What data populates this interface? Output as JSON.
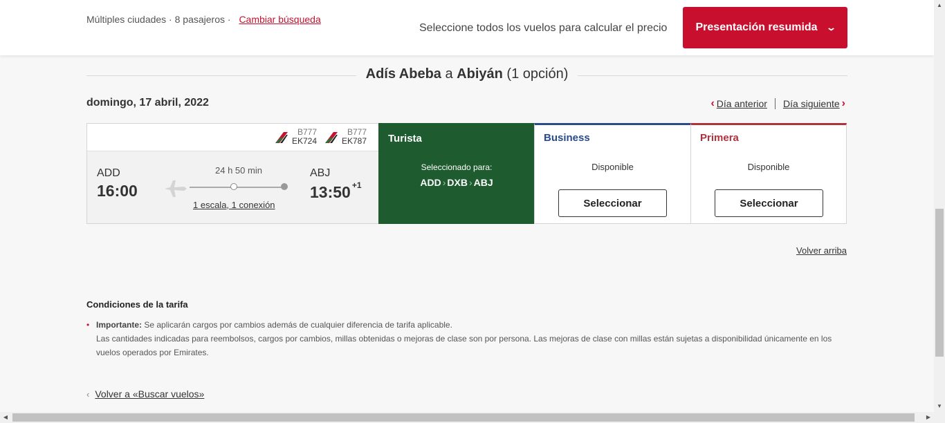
{
  "header": {
    "search_info": "Múltiples ciudades · 8 pasajeros ·",
    "change_search": "Cambiar búsqueda",
    "price_hint": "Seleccione todos los vuelos para calcular el precio",
    "summary_button": "Presentación resumida"
  },
  "route": {
    "origin": "Adís Abeba",
    "connector": "a",
    "destination": "Abiyán",
    "options": "(1 opción)"
  },
  "date": "domingo, 17 abril, 2022",
  "day_nav": {
    "prev": "Día anterior",
    "next": "Día siguiente"
  },
  "flight": {
    "segments": [
      {
        "aircraft": "B777",
        "flight_no": "EK724"
      },
      {
        "aircraft": "B777",
        "flight_no": "EK787"
      }
    ],
    "departure_code": "ADD",
    "departure_time": "16:00",
    "duration": "24 h 50 min",
    "stops": "1 escala, 1 conexión",
    "arrival_code": "ABJ",
    "arrival_time": "13:50",
    "day_offset": "+1"
  },
  "fares": {
    "economy": {
      "name": "Turista",
      "selected_for": "Seleccionado para:",
      "route": [
        "ADD",
        "DXB",
        "ABJ"
      ],
      "color": "#1e5b2e"
    },
    "business": {
      "name": "Business",
      "status": "Disponible",
      "button": "Seleccionar",
      "color": "#2a4a8a"
    },
    "first": {
      "name": "Primera",
      "status": "Disponible",
      "button": "Seleccionar",
      "color": "#b0323c"
    }
  },
  "back_to_top": "Volver arriba",
  "conditions": {
    "title": "Condiciones de la tarifa",
    "important_label": "Importante:",
    "important_text": "Se aplicarán cargos por cambios además de cualquier diferencia de tarifa aplicable.",
    "detail": "Las cantidades indicadas para reembolsos, cargos por cambios, millas obtenidas o mejoras de clase son por persona. Las mejoras de clase con millas están sujetas a disponibilidad únicamente en los vuelos operados por Emirates."
  },
  "back_search": "Volver a «Buscar vuelos»",
  "colors": {
    "brand_red": "#c8102e"
  }
}
